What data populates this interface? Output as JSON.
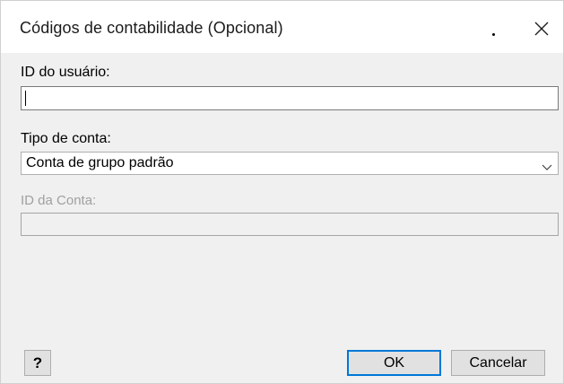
{
  "dialog": {
    "title": "Códigos de contabilidade (Opcional)"
  },
  "fields": {
    "user_id": {
      "label": "ID do usuário:",
      "value": ""
    },
    "account_type": {
      "label": "Tipo de conta:",
      "selected": "Conta de grupo padrão"
    },
    "account_id": {
      "label": "ID da Conta:",
      "value": "",
      "enabled": false
    }
  },
  "buttons": {
    "help_label": "?",
    "ok_label": "OK",
    "cancel_label": "Cancelar"
  },
  "icons": {
    "close": "close-icon",
    "dropdown": "chevron-down-icon"
  },
  "colors": {
    "default_button_border": "#0078d7",
    "disabled_text": "#a0a0a0"
  }
}
